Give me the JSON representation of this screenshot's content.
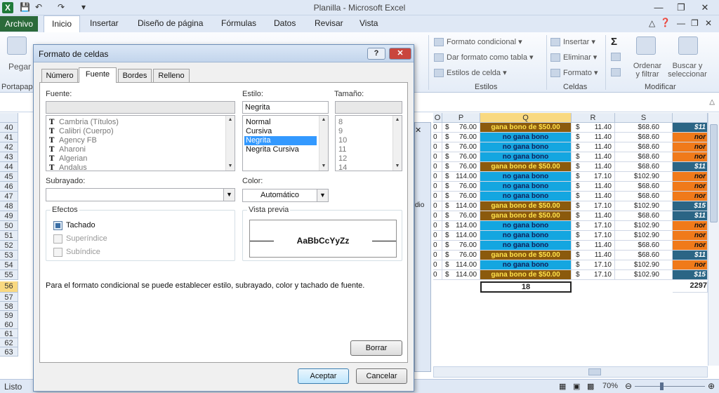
{
  "app": {
    "title": "Planilla - Microsoft Excel",
    "status": "Listo",
    "zoom": "70%"
  },
  "tabs": [
    "Archivo",
    "Inicio",
    "Insertar",
    "Diseño de página",
    "Fórmulas",
    "Datos",
    "Revisar",
    "Vista"
  ],
  "ribbon": {
    "pegar": "Pegar",
    "portapapeles": "Portapap",
    "formato_condicional": "Formato condicional",
    "dar_formato_tabla": "Dar formato como tabla",
    "estilos_celda": "Estilos de celda",
    "estilos": "Estilos",
    "insertar": "Insertar",
    "eliminar": "Eliminar",
    "formato": "Formato",
    "celdas": "Celdas",
    "ordenar_1": "Ordenar",
    "ordenar_2": "y filtrar",
    "buscar_1": "Buscar y",
    "buscar_2": "seleccionar",
    "modificar": "Modificar"
  },
  "sheet": {
    "columns": [
      "O",
      "P",
      "Q",
      "R",
      "S"
    ],
    "rows": [
      {
        "n": "40",
        "o": "0",
        "p": "76.00",
        "q": "gana bono de $50.00",
        "qt": "bono",
        "r": "11.40",
        "s": "$68.60",
        "t": "$11",
        "tt": "bl"
      },
      {
        "n": "41",
        "o": "0",
        "p": "76.00",
        "q": "no gana bono",
        "qt": "no",
        "r": "11.40",
        "s": "$68.60",
        "t": "nor",
        "tt": "or"
      },
      {
        "n": "42",
        "o": "0",
        "p": "76.00",
        "q": "no gana bono",
        "qt": "no",
        "r": "11.40",
        "s": "$68.60",
        "t": "nor",
        "tt": "or"
      },
      {
        "n": "43",
        "o": "0",
        "p": "76.00",
        "q": "no gana bono",
        "qt": "no",
        "r": "11.40",
        "s": "$68.60",
        "t": "nor",
        "tt": "or"
      },
      {
        "n": "44",
        "o": "0",
        "p": "76.00",
        "q": "gana bono de $50.00",
        "qt": "bono",
        "r": "11.40",
        "s": "$68.60",
        "t": "$11",
        "tt": "bl"
      },
      {
        "n": "45",
        "o": "0",
        "p": "114.00",
        "q": "no gana bono",
        "qt": "no",
        "r": "17.10",
        "s": "$102.90",
        "t": "nor",
        "tt": "or"
      },
      {
        "n": "46",
        "o": "0",
        "p": "76.00",
        "q": "no gana bono",
        "qt": "no",
        "r": "11.40",
        "s": "$68.60",
        "t": "nor",
        "tt": "or"
      },
      {
        "n": "47",
        "o": "0",
        "p": "76.00",
        "q": "no gana bono",
        "qt": "no",
        "r": "11.40",
        "s": "$68.60",
        "t": "nor",
        "tt": "or"
      },
      {
        "n": "48",
        "o": "0",
        "p": "114.00",
        "q": "gana bono de $50.00",
        "qt": "bono",
        "r": "17.10",
        "s": "$102.90",
        "t": "$15",
        "tt": "bl"
      },
      {
        "n": "49",
        "o": "0",
        "p": "76.00",
        "q": "gana bono de $50.00",
        "qt": "bono",
        "r": "11.40",
        "s": "$68.60",
        "t": "$11",
        "tt": "bl"
      },
      {
        "n": "50",
        "o": "0",
        "p": "114.00",
        "q": "no gana bono",
        "qt": "no",
        "r": "17.10",
        "s": "$102.90",
        "t": "nor",
        "tt": "or"
      },
      {
        "n": "51",
        "o": "0",
        "p": "114.00",
        "q": "no gana bono",
        "qt": "no",
        "r": "17.10",
        "s": "$102.90",
        "t": "nor",
        "tt": "or"
      },
      {
        "n": "52",
        "o": "0",
        "p": "76.00",
        "q": "no gana bono",
        "qt": "no",
        "r": "11.40",
        "s": "$68.60",
        "t": "nor",
        "tt": "or"
      },
      {
        "n": "53",
        "o": "0",
        "p": "76.00",
        "q": "gana bono de $50.00",
        "qt": "bono",
        "r": "11.40",
        "s": "$68.60",
        "t": "$11",
        "tt": "bl"
      },
      {
        "n": "54",
        "o": "0",
        "p": "114.00",
        "q": "no gana bono",
        "qt": "no",
        "r": "17.10",
        "s": "$102.90",
        "t": "nor",
        "tt": "or"
      },
      {
        "n": "55",
        "o": "0",
        "p": "114.00",
        "q": "gana bono de $50.00",
        "qt": "bono",
        "r": "17.10",
        "s": "$102.90",
        "t": "$15",
        "tt": "bl"
      }
    ],
    "total_row": {
      "n": "56",
      "q": "18",
      "t": "2297"
    },
    "extra_rows": [
      "57",
      "58",
      "59",
      "60",
      "61",
      "62",
      "63"
    ],
    "background_dialog_text": "dio"
  },
  "dialog": {
    "title": "Formato de celdas",
    "tabs": [
      "Número",
      "Fuente",
      "Bordes",
      "Relleno"
    ],
    "fuente_label": "Fuente:",
    "fuente_value": "",
    "fonts": [
      "Cambria (Títulos)",
      "Calibri (Cuerpo)",
      "Agency FB",
      "Aharoni",
      "Algerian",
      "Andalus"
    ],
    "estilo_label": "Estilo:",
    "estilo_value": "Negrita",
    "styles": [
      "Normal",
      "Cursiva",
      "Negrita",
      "Negrita Cursiva"
    ],
    "selected_style": "Negrita",
    "tamano_label": "Tamaño:",
    "tamano_value": "",
    "sizes": [
      "8",
      "9",
      "10",
      "11",
      "12",
      "14"
    ],
    "subrayado_label": "Subrayado:",
    "subrayado_value": "",
    "color_label": "Color:",
    "color_value": "Automático",
    "efectos_label": "Efectos",
    "tachado": "Tachado",
    "superindice": "Superíndice",
    "subindice": "Subíndice",
    "vista_previa_label": "Vista previa",
    "preview_text": "AaBbCcYyZz",
    "info_text": "Para el formato condicional se puede establecer estilo, subrayado, color y tachado de fuente.",
    "borrar": "Borrar",
    "aceptar": "Aceptar",
    "cancelar": "Cancelar"
  }
}
